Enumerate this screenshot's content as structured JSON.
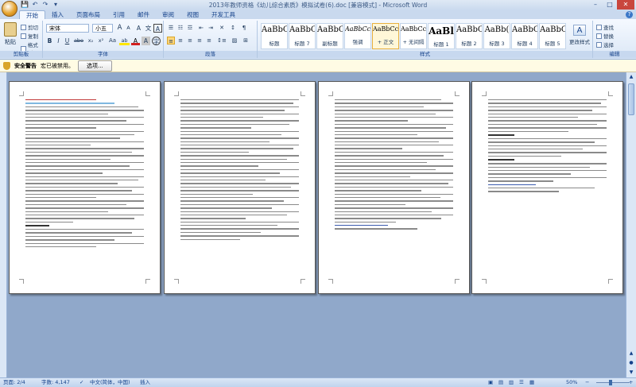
{
  "window": {
    "title": "2013年教师资格《幼儿综合素质》模拟试卷(6).doc [兼容模式] - Microsoft Word",
    "minimize": "–",
    "maximize": "□",
    "close": "✕"
  },
  "qat": {
    "save": "💾",
    "undo": "↶",
    "redo": "↷",
    "more": "▾"
  },
  "tabs": [
    "开始",
    "插入",
    "页面布局",
    "引用",
    "邮件",
    "审阅",
    "视图",
    "开发工具"
  ],
  "help": "?",
  "clipboard": {
    "paste": "粘贴",
    "cut": "剪切",
    "copy": "复制",
    "format_painter": "格式刷",
    "label": "剪贴板"
  },
  "font": {
    "name": "宋体",
    "size": "小五",
    "grow": "A",
    "shrink": "A",
    "clear": "A",
    "phonetic": "文",
    "border": "A",
    "bold": "B",
    "italic": "I",
    "underline": "U",
    "strike": "abe",
    "subscript": "x₂",
    "superscript": "x²",
    "case": "Aa",
    "highlight": "ab",
    "color": "A",
    "shade": "A",
    "circle": "字",
    "label": "字体"
  },
  "paragraph": {
    "bullets": "☰",
    "numbering": "☷",
    "multilevel": "☲",
    "outdent": "⇤",
    "indent": "⇥",
    "chinese_layout": "✕",
    "sort": "↕",
    "show_marks": "¶",
    "align_left": "≡",
    "center": "≡",
    "align_right": "≡",
    "justify": "≡",
    "distributed": "≡",
    "line_spacing": "↕≡",
    "shading": "▨",
    "borders": "⊞",
    "label": "段落"
  },
  "styles": {
    "items": [
      {
        "preview": "AaBbC",
        "name": "标题"
      },
      {
        "preview": "AaBbCc",
        "name": "标题 7"
      },
      {
        "preview": "AaBbC",
        "name": "副标题"
      },
      {
        "preview": "AaBbCcD",
        "name": "强调"
      },
      {
        "preview": "AaBbCcD",
        "name": "+ 正文"
      },
      {
        "preview": "AaBbCcD",
        "name": "+ 无间隔"
      },
      {
        "preview": "AaBl",
        "name": "标题 1"
      },
      {
        "preview": "AaBbC",
        "name": "标题 2"
      },
      {
        "preview": "AaBb(",
        "name": "标题 3"
      },
      {
        "preview": "AaBbC",
        "name": "标题 4"
      },
      {
        "preview": "AaBbC",
        "name": "标题 5"
      }
    ],
    "change": "更改样式",
    "label": "样式"
  },
  "editing": {
    "find": "查找",
    "replace": "替换",
    "select": "选择",
    "label": "编辑"
  },
  "security": {
    "title": "安全警告",
    "message": "宏已被禁用。",
    "options": "选项..."
  },
  "status": {
    "page": "页面: 2/4",
    "words": "字数: 4,147",
    "language": "中文(简体，中国)",
    "mode": "插入",
    "zoom": "50%",
    "zoom_out": "−",
    "zoom_in": "+"
  },
  "scroll": {
    "up": "▲",
    "down": "▼",
    "prev": "▲",
    "select": "●",
    "next": "▼"
  }
}
